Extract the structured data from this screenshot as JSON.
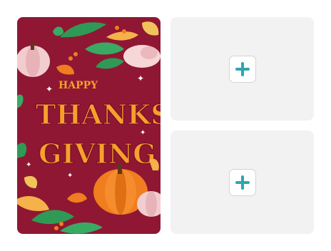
{
  "card": {
    "line1": "HAPPY",
    "line2": "THANKS",
    "line3": "GIVING",
    "colors": {
      "background": "#8f1733",
      "lettering": "#f5a02c",
      "pumpkin": "#f07d1e",
      "leaf": "#2f9a55"
    }
  },
  "slots": [
    {
      "icon": "plus-icon"
    },
    {
      "icon": "plus-icon"
    }
  ]
}
